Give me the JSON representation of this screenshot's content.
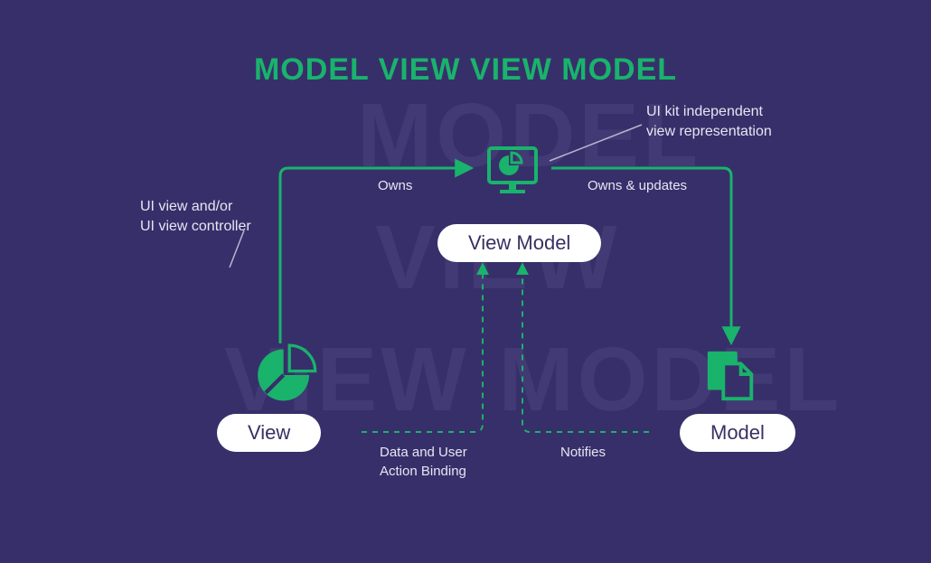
{
  "title": "MODEL VIEW VIEW MODEL",
  "ghost": {
    "line1": "MODEL",
    "line2": "VIEW",
    "line3": "VIEW MODEL"
  },
  "nodes": {
    "view": {
      "label": "View"
    },
    "viewmodel": {
      "label": "View Model"
    },
    "model": {
      "label": "Model"
    }
  },
  "descriptions": {
    "view": "UI view and/or\nUI view controller",
    "viewmodel": "UI kit independent\nview representation"
  },
  "edges": {
    "view_to_viewmodel": "Owns",
    "viewmodel_to_model": "Owns & updates",
    "view_binding": "Data and User\nAction Binding",
    "model_notifies": "Notifies"
  },
  "colors": {
    "bg": "#372f6a",
    "accent": "#19b36c",
    "pill_bg": "#ffffff",
    "text_light": "#e8e5f2",
    "ghost": "#423a74"
  }
}
